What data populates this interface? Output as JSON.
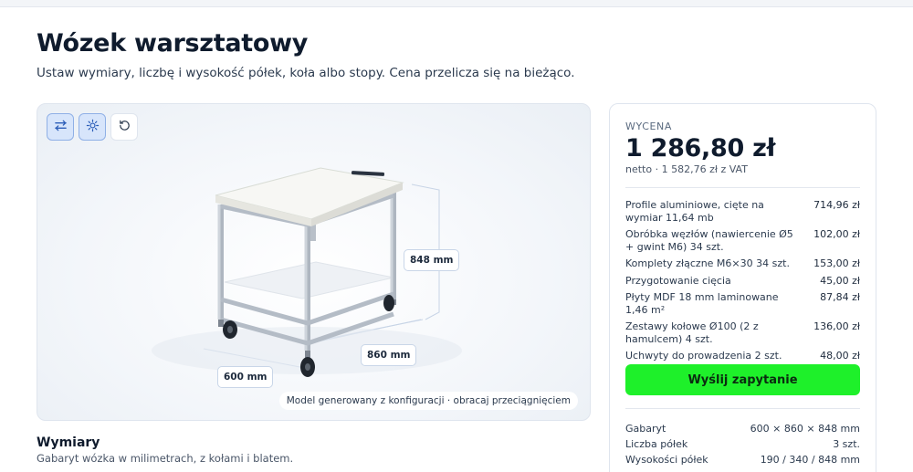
{
  "header": {
    "title": "Wózek warsztatowy",
    "subtitle": "Ustaw wymiary, liczbę i wysokość półek, koła albo stopy. Cena przelicza się na bieżąco."
  },
  "viewer": {
    "tools": [
      {
        "icon": "dimensions-icon",
        "active": true
      },
      {
        "icon": "light-icon",
        "active": true
      },
      {
        "icon": "reset-view-icon",
        "active": false
      }
    ],
    "dimensions": {
      "height": "848 mm",
      "length": "860 mm",
      "width": "600 mm"
    },
    "caption": "Model generowany z konfiguracji · obracaj przeciągnięciem"
  },
  "dimensions_section": {
    "title": "Wymiary",
    "subtitle": "Gabaryt wózka w milimetrach, z kołami i blatem."
  },
  "quote": {
    "label": "WYCENA",
    "price": "1 286,80 zł",
    "net": "netto · 1 582,76 zł z VAT",
    "items": [
      {
        "name": "Profile aluminiowe, cięte na wymiar 11,64 mb",
        "value": "714,96 zł"
      },
      {
        "name": "Obróbka węzłów (nawiercenie Ø5 + gwint M6) 34 szt.",
        "value": "102,00 zł"
      },
      {
        "name": "Komplety złączne M6×30 34 szt.",
        "value": "153,00 zł"
      },
      {
        "name": "Przygotowanie cięcia",
        "value": "45,00 zł"
      },
      {
        "name": "Płyty MDF 18 mm laminowane 1,46 m²",
        "value": "87,84 zł"
      },
      {
        "name": "Zestawy kołowe Ø100 (2 z hamulcem) 4 szt.",
        "value": "136,00 zł"
      },
      {
        "name": "Uchwyty do prowadzenia 2 szt.",
        "value": "48,00 zł"
      }
    ],
    "submit_label": "Wyślij zapytanie",
    "specs": [
      {
        "label": "Gabaryt",
        "value": "600 × 860 × 848 mm"
      },
      {
        "label": "Liczba półek",
        "value": "3 szt."
      },
      {
        "label": "Wysokości półek",
        "value": "190 / 340 / 848 mm"
      }
    ]
  },
  "colors": {
    "accent": "#1ef02a",
    "tool_active_bg": "#d7e5fb",
    "text_primary": "#0f1b2d"
  }
}
